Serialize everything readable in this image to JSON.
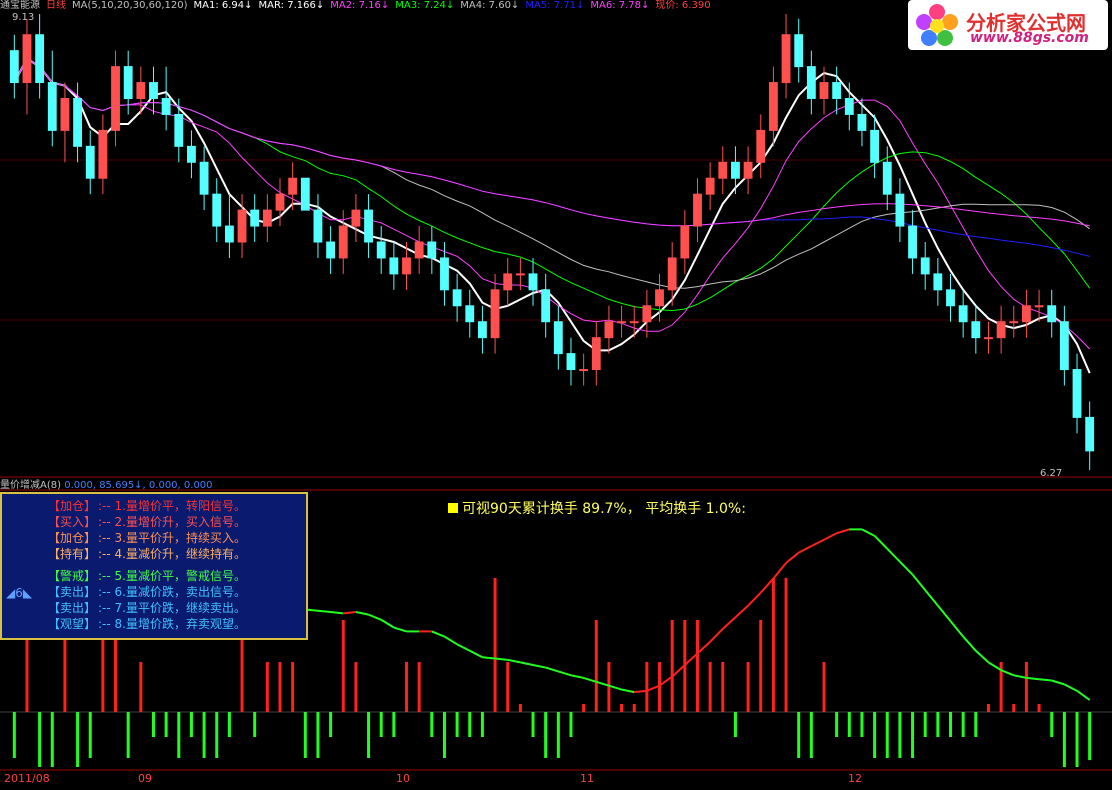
{
  "header": {
    "title": "通宝能源",
    "period": "日线",
    "ma_params": "MA(5,10,20,30,60,120)",
    "ma1": "MA1: 6.94↓",
    "mar": "MAR: 7.166↓",
    "ma2": "MA2: 7.16↓",
    "ma3": "MA3: 7.24↓",
    "ma4": "MA4: 7.60↓",
    "ma5": "MA5: 7.71↓",
    "ma6": "MA6: 7.78↓",
    "price": "现价: 6.390",
    "high_label": "9.13",
    "low_label": "6.27"
  },
  "sub_header": {
    "indicator": "量价增减A(8)",
    "values": "0.000, 85.695↓, 0.000, 0.000"
  },
  "legend": [
    {
      "tag": "【加仓】",
      "text": ":-- 1.量增价平，转阳信号。",
      "color": "#ff3030"
    },
    {
      "tag": "【买入】",
      "text": ":-- 2.量增价升，买入信号。",
      "color": "#ff5050"
    },
    {
      "tag": "【加仓】",
      "text": ":-- 3.量平价升，持续买入。",
      "color": "#ff9050"
    },
    {
      "tag": "【持有】",
      "text": ":-- 4.量减价升，继续持有。",
      "color": "#ffb060"
    },
    {
      "tag": "【警戒】",
      "text": ":-- 5.量减价平，警戒信号。",
      "color": "#40ff40"
    },
    {
      "tag": "【卖出】",
      "text": ":-- 6.量减价跌，卖出信号。",
      "color": "#40c0ff"
    },
    {
      "tag": "【卖出】",
      "text": ":-- 7.量平价跌，继续卖出。",
      "color": "#40c0ff"
    },
    {
      "tag": "【观望】",
      "text": ":-- 8.量增价跌，弃卖观望。",
      "color": "#40c0ff"
    }
  ],
  "counter": "◢6◣",
  "turnover": "可视90天累计换手 89.7%，  平均换手 1.0%:",
  "logo": {
    "brand": "分析家公式网",
    "url": "www.88gs.com"
  },
  "dates": [
    "2011/08",
    "09",
    "10",
    "11",
    "12"
  ],
  "colors": {
    "up": "#ff5050",
    "up_fill": "#000000",
    "down": "#54ffff",
    "ma5": "#ffffff",
    "ma10": "#ffff00",
    "ma20": "#ff40ff",
    "ma30": "#00ff00",
    "ma60": "#c0c0c0",
    "ma120": "#ff40ff",
    "ma_long": "#2020ff",
    "positive_bar": "#ff2020",
    "negative_bar": "#20ff20"
  },
  "chart_data": {
    "type": "candlestick",
    "y_range": [
      6.27,
      9.13
    ],
    "candles": [
      [
        8.9,
        9.0,
        8.6,
        8.7
      ],
      [
        8.7,
        9.1,
        8.5,
        9.0
      ],
      [
        9.0,
        9.13,
        8.6,
        8.7
      ],
      [
        8.7,
        8.9,
        8.3,
        8.4
      ],
      [
        8.4,
        8.7,
        8.2,
        8.6
      ],
      [
        8.6,
        8.7,
        8.2,
        8.3
      ],
      [
        8.3,
        8.4,
        8.0,
        8.1
      ],
      [
        8.1,
        8.5,
        8.0,
        8.4
      ],
      [
        8.4,
        8.9,
        8.3,
        8.8
      ],
      [
        8.8,
        8.9,
        8.5,
        8.6
      ],
      [
        8.6,
        8.8,
        8.5,
        8.7
      ],
      [
        8.7,
        8.8,
        8.5,
        8.6
      ],
      [
        8.6,
        8.8,
        8.4,
        8.5
      ],
      [
        8.5,
        8.6,
        8.2,
        8.3
      ],
      [
        8.3,
        8.4,
        8.1,
        8.2
      ],
      [
        8.2,
        8.3,
        7.9,
        8.0
      ],
      [
        8.0,
        8.1,
        7.7,
        7.8
      ],
      [
        7.8,
        8.0,
        7.6,
        7.7
      ],
      [
        7.7,
        8.0,
        7.6,
        7.9
      ],
      [
        7.9,
        8.0,
        7.7,
        7.8
      ],
      [
        7.8,
        8.0,
        7.7,
        7.9
      ],
      [
        7.9,
        8.1,
        7.8,
        8.0
      ],
      [
        8.0,
        8.2,
        7.9,
        8.1
      ],
      [
        8.1,
        8.1,
        7.9,
        7.9
      ],
      [
        7.9,
        8.0,
        7.6,
        7.7
      ],
      [
        7.7,
        7.8,
        7.5,
        7.6
      ],
      [
        7.6,
        7.9,
        7.5,
        7.8
      ],
      [
        7.8,
        8.0,
        7.7,
        7.9
      ],
      [
        7.9,
        8.0,
        7.6,
        7.7
      ],
      [
        7.7,
        7.8,
        7.5,
        7.6
      ],
      [
        7.6,
        7.7,
        7.4,
        7.5
      ],
      [
        7.5,
        7.7,
        7.4,
        7.6
      ],
      [
        7.6,
        7.8,
        7.5,
        7.7
      ],
      [
        7.7,
        7.8,
        7.5,
        7.6
      ],
      [
        7.6,
        7.7,
        7.3,
        7.4
      ],
      [
        7.4,
        7.5,
        7.2,
        7.3
      ],
      [
        7.3,
        7.4,
        7.1,
        7.2
      ],
      [
        7.2,
        7.3,
        7.0,
        7.1
      ],
      [
        7.1,
        7.5,
        7.0,
        7.4
      ],
      [
        7.4,
        7.6,
        7.3,
        7.5
      ],
      [
        7.5,
        7.6,
        7.4,
        7.5
      ],
      [
        7.5,
        7.6,
        7.3,
        7.4
      ],
      [
        7.4,
        7.5,
        7.1,
        7.2
      ],
      [
        7.2,
        7.3,
        6.9,
        7.0
      ],
      [
        7.0,
        7.1,
        6.8,
        6.9
      ],
      [
        6.9,
        7.0,
        6.8,
        6.9
      ],
      [
        6.9,
        7.2,
        6.8,
        7.1
      ],
      [
        7.1,
        7.3,
        7.0,
        7.2
      ],
      [
        7.2,
        7.3,
        7.1,
        7.2
      ],
      [
        7.2,
        7.3,
        7.1,
        7.2
      ],
      [
        7.2,
        7.4,
        7.1,
        7.3
      ],
      [
        7.3,
        7.5,
        7.2,
        7.4
      ],
      [
        7.4,
        7.7,
        7.3,
        7.6
      ],
      [
        7.6,
        7.9,
        7.5,
        7.8
      ],
      [
        7.8,
        8.1,
        7.7,
        8.0
      ],
      [
        8.0,
        8.2,
        7.9,
        8.1
      ],
      [
        8.1,
        8.3,
        8.0,
        8.2
      ],
      [
        8.2,
        8.3,
        8.0,
        8.1
      ],
      [
        8.1,
        8.3,
        8.0,
        8.2
      ],
      [
        8.2,
        8.5,
        8.1,
        8.4
      ],
      [
        8.4,
        8.8,
        8.3,
        8.7
      ],
      [
        8.7,
        9.13,
        8.6,
        9.0
      ],
      [
        9.0,
        9.1,
        8.7,
        8.8
      ],
      [
        8.8,
        8.9,
        8.5,
        8.6
      ],
      [
        8.6,
        8.8,
        8.5,
        8.7
      ],
      [
        8.7,
        8.8,
        8.5,
        8.6
      ],
      [
        8.6,
        8.7,
        8.4,
        8.5
      ],
      [
        8.5,
        8.6,
        8.3,
        8.4
      ],
      [
        8.4,
        8.5,
        8.1,
        8.2
      ],
      [
        8.2,
        8.3,
        7.9,
        8.0
      ],
      [
        8.0,
        8.1,
        7.7,
        7.8
      ],
      [
        7.8,
        7.9,
        7.5,
        7.6
      ],
      [
        7.6,
        7.7,
        7.4,
        7.5
      ],
      [
        7.5,
        7.6,
        7.3,
        7.4
      ],
      [
        7.4,
        7.5,
        7.2,
        7.3
      ],
      [
        7.3,
        7.4,
        7.1,
        7.2
      ],
      [
        7.2,
        7.3,
        7.0,
        7.1
      ],
      [
        7.1,
        7.2,
        7.0,
        7.1
      ],
      [
        7.1,
        7.3,
        7.0,
        7.2
      ],
      [
        7.2,
        7.3,
        7.1,
        7.2
      ],
      [
        7.2,
        7.4,
        7.1,
        7.3
      ],
      [
        7.3,
        7.4,
        7.2,
        7.3
      ],
      [
        7.3,
        7.4,
        7.1,
        7.2
      ],
      [
        7.2,
        7.3,
        6.8,
        6.9
      ],
      [
        6.9,
        7.0,
        6.5,
        6.6
      ],
      [
        6.6,
        6.7,
        6.27,
        6.39
      ]
    ]
  }
}
